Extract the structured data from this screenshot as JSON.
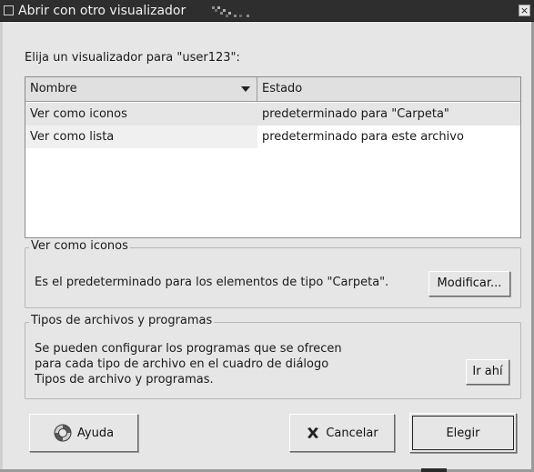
{
  "window": {
    "title": "Abrir con otro visualizador",
    "close_glyph": "×"
  },
  "prompt": "Elija un visualizador para \"user123\":",
  "list": {
    "columns": [
      "Nombre",
      "Estado"
    ],
    "rows": [
      {
        "name": "Ver como iconos",
        "status": "predeterminado para \"Carpeta\""
      },
      {
        "name": "Ver como lista",
        "status": "predeterminado para este archivo"
      }
    ]
  },
  "group_selected": {
    "legend": "Ver como iconos",
    "text": "Es el predeterminado para los elementos de tipo \"Carpeta\".",
    "button_label": "Modificar..."
  },
  "group_filetypes": {
    "legend": "Tipos de archivos y programas",
    "lines": [
      "Se pueden configurar los programas que se ofrecen",
      "para cada tipo de archivo en el cuadro de diálogo",
      "Tipos de archivo y programas."
    ],
    "button_label": "Ir ahí"
  },
  "buttons": {
    "help": "Ayuda",
    "cancel": "Cancelar",
    "choose": "Elegir"
  },
  "icons": {
    "help": "lifebuoy-help-icon",
    "cancel": "x-cancel-icon",
    "sort": "sort-down-icon"
  }
}
